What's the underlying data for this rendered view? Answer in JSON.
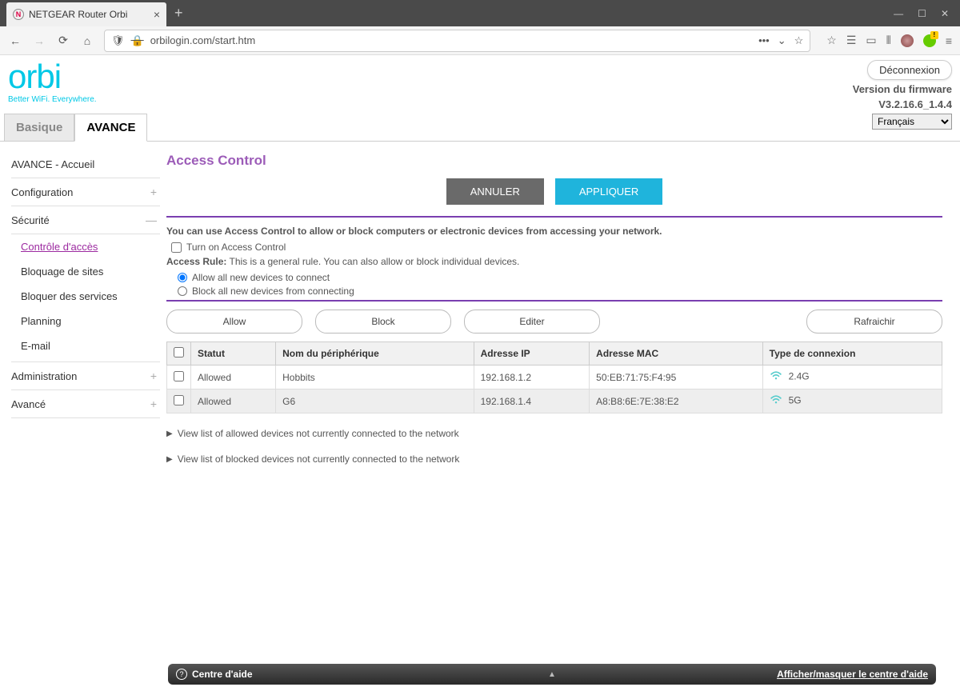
{
  "browser": {
    "tab_title": "NETGEAR Router Orbi",
    "url": "orbilogin.com/start.htm"
  },
  "header": {
    "logo_main": "orbi",
    "logo_tagline": "Better WiFi. Everywhere.",
    "logout": "Déconnexion",
    "fw_label": "Version du firmware",
    "fw_version": "V3.2.16.6_1.4.4",
    "language": "Français"
  },
  "main_tabs": {
    "basic": "Basique",
    "advanced": "AVANCE"
  },
  "sidebar": {
    "home": "AVANCE - Accueil",
    "config": "Configuration",
    "security": "Sécurité",
    "sub": {
      "access": "Contrôle d'accès",
      "block_sites": "Bloquage de sites",
      "block_services": "Bloquer des services",
      "planning": "Planning",
      "email": "E-mail"
    },
    "admin": "Administration",
    "advanced": "Avancé"
  },
  "content": {
    "title": "Access Control",
    "cancel": "ANNULER",
    "apply": "APPLIQUER",
    "intro": "You can use Access Control to allow or block computers or electronic devices from accessing your network.",
    "turn_on": "Turn on Access Control",
    "rule_bold": "Access Rule:",
    "rule_text": " This is a general rule. You can also allow or block individual devices.",
    "radio_allow": "Allow all new devices to connect",
    "radio_block": "Block all new devices from connecting",
    "btn_allow": "Allow",
    "btn_block": "Block",
    "btn_edit": "Editer",
    "btn_refresh": "Rafraichir",
    "cols": {
      "status": "Statut",
      "name": "Nom du périphérique",
      "ip": "Adresse IP",
      "mac": "Adresse MAC",
      "conn": "Type de connexion"
    },
    "rows": [
      {
        "status": "Allowed",
        "name": "Hobbits",
        "ip": "192.168.1.2",
        "mac": "50:EB:71:75:F4:95",
        "conn": "2.4G"
      },
      {
        "status": "Allowed",
        "name": "G6",
        "ip": "192.168.1.4",
        "mac": "A8:B8:6E:7E:38:E2",
        "conn": "5G"
      }
    ],
    "link_allowed": "View list of allowed devices not currently connected to the network",
    "link_blocked": "View list of blocked devices not currently connected to the network"
  },
  "footer": {
    "help": "Centre d'aide",
    "toggle": "Afficher/masquer le centre d'aide"
  }
}
